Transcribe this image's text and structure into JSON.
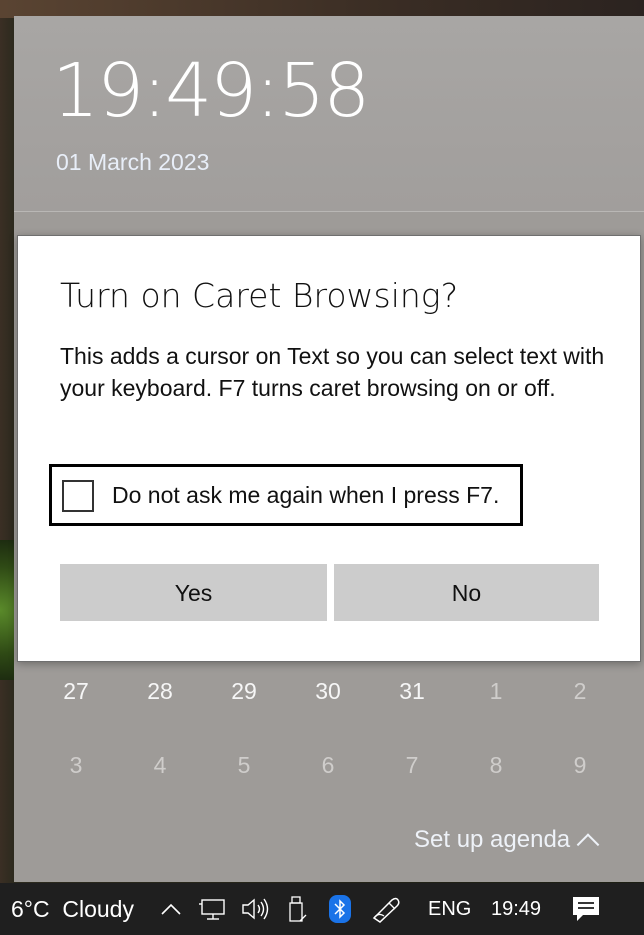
{
  "clock": {
    "time": "19:49:58",
    "date": "01 March 2023"
  },
  "calendar": {
    "row1": [
      "27",
      "28",
      "29",
      "30",
      "31",
      "1",
      "2"
    ],
    "row2": [
      "3",
      "4",
      "5",
      "6",
      "7",
      "8",
      "9"
    ]
  },
  "agenda": {
    "label": "Set up agenda"
  },
  "dialog": {
    "title": "Turn on Caret Browsing?",
    "body": "This adds a cursor on Text so you can select text with your keyboard. F7 turns caret browsing on or off.",
    "checkbox_label": "Do not ask me again when I press F7.",
    "checkbox_checked": false,
    "yes_label": "Yes",
    "no_label": "No"
  },
  "taskbar": {
    "weather": "6°C  Cloudy",
    "language": "ENG",
    "time": "19:49",
    "icons": [
      "chevron-up-icon",
      "network-icon",
      "volume-icon",
      "usb-drive-icon",
      "bluetooth-icon",
      "pen-icon",
      "notification-icon"
    ],
    "bluetooth_color": "#1a73e8"
  }
}
